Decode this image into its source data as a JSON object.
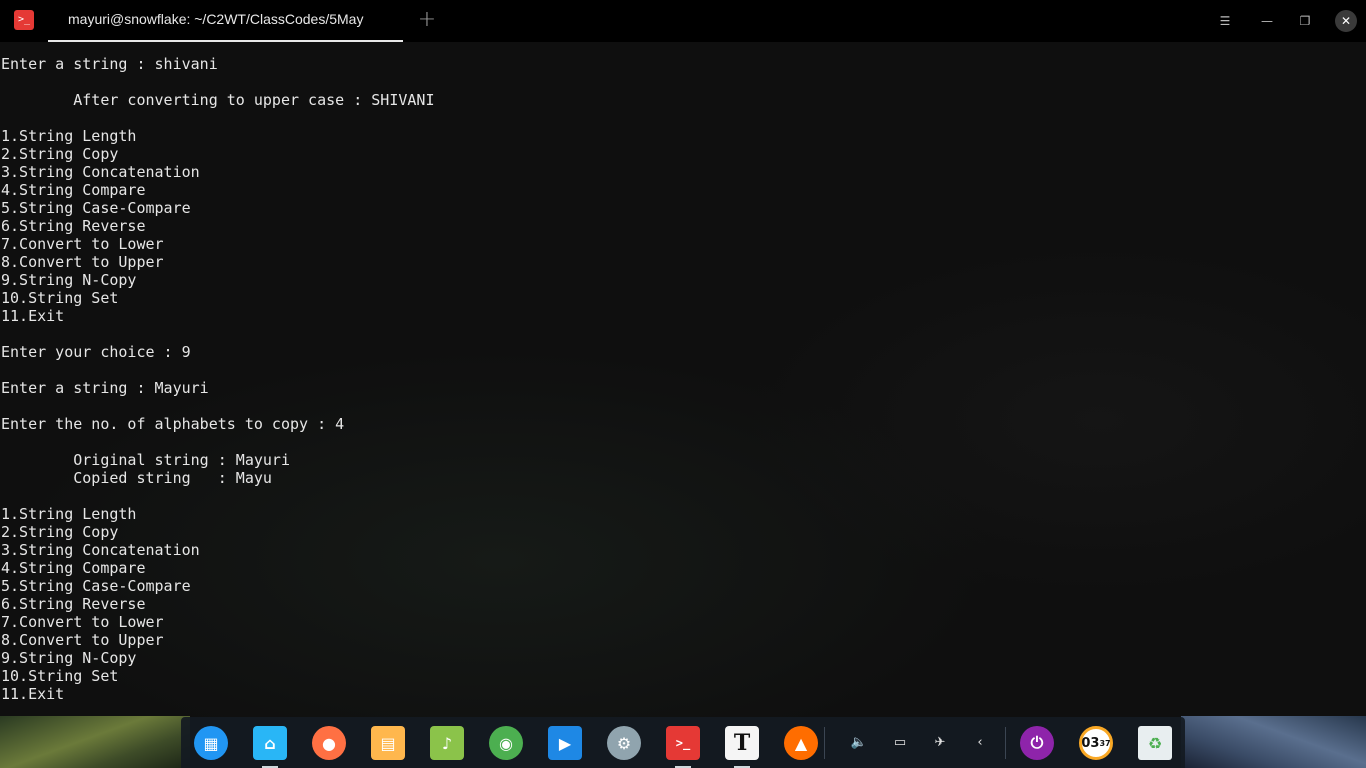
{
  "window": {
    "title": "mayuri@snowflake: ~/C2WT/ClassCodes/5May",
    "app_icon_glyph": ">_",
    "add_tab_glyph": "+",
    "menu_glyph": "☰",
    "minimize_glyph": "—",
    "maximize_glyph": "❐",
    "close_glyph": "✕"
  },
  "terminal": {
    "lines": [
      "Enter a string : shivani",
      "",
      "        After converting to upper case : SHIVANI",
      "",
      "1.String Length",
      "2.String Copy",
      "3.String Concatenation",
      "4.String Compare",
      "5.String Case-Compare",
      "6.String Reverse",
      "7.Convert to Lower",
      "8.Convert to Upper",
      "9.String N-Copy",
      "10.String Set",
      "11.Exit",
      "",
      "Enter your choice : 9",
      "",
      "Enter a string : Mayuri",
      "",
      "Enter the no. of alphabets to copy : 4",
      "",
      "        Original string : Mayuri",
      "        Copied string   : Mayu",
      "",
      "1.String Length",
      "2.String Copy",
      "3.String Concatenation",
      "4.String Compare",
      "5.String Case-Compare",
      "6.String Reverse",
      "7.Convert to Lower",
      "8.Convert to Upper",
      "9.String N-Copy",
      "10.String Set",
      "11.Exit"
    ]
  },
  "dock": {
    "apps": [
      {
        "name": "launcher-icon",
        "glyph": "▦",
        "color": "#2196f3",
        "running": false
      },
      {
        "name": "file-manager-icon",
        "glyph": "⌂",
        "color": "#29b6f6",
        "running": true
      },
      {
        "name": "screen-recorder-icon",
        "glyph": "●",
        "color": "#ff7043",
        "running": false
      },
      {
        "name": "app-store-icon",
        "glyph": "▤",
        "color": "#ffb74d",
        "running": false
      },
      {
        "name": "music-player-icon",
        "glyph": "♪",
        "color": "#8bc34a",
        "running": false
      },
      {
        "name": "chrome-browser-icon",
        "glyph": "◉",
        "color": "#4caf50",
        "running": false
      },
      {
        "name": "video-player-icon",
        "glyph": "▶",
        "color": "#1e88e5",
        "running": false
      },
      {
        "name": "settings-icon",
        "glyph": "⚙",
        "color": "#90a4ae",
        "running": false
      },
      {
        "name": "terminal-icon",
        "glyph": ">_",
        "color": "#e53935",
        "running": true
      },
      {
        "name": "text-editor-icon",
        "glyph": "T",
        "color": "#f5f5f5",
        "running": true
      },
      {
        "name": "downloader-icon",
        "glyph": "▲",
        "color": "#ff6d00",
        "running": false
      }
    ],
    "tray": [
      {
        "name": "volume-icon",
        "glyph": "🔈"
      },
      {
        "name": "battery-icon",
        "glyph": "▭"
      },
      {
        "name": "network-off-icon",
        "glyph": "✈"
      },
      {
        "name": "tray-expand-icon",
        "glyph": "‹"
      }
    ],
    "power": {
      "name": "power-icon",
      "glyph": "⏻",
      "color": "#8e24aa"
    },
    "clock": {
      "hour": "03",
      "minute": "37"
    },
    "trash": {
      "name": "trash-icon",
      "glyph": "♻"
    }
  }
}
